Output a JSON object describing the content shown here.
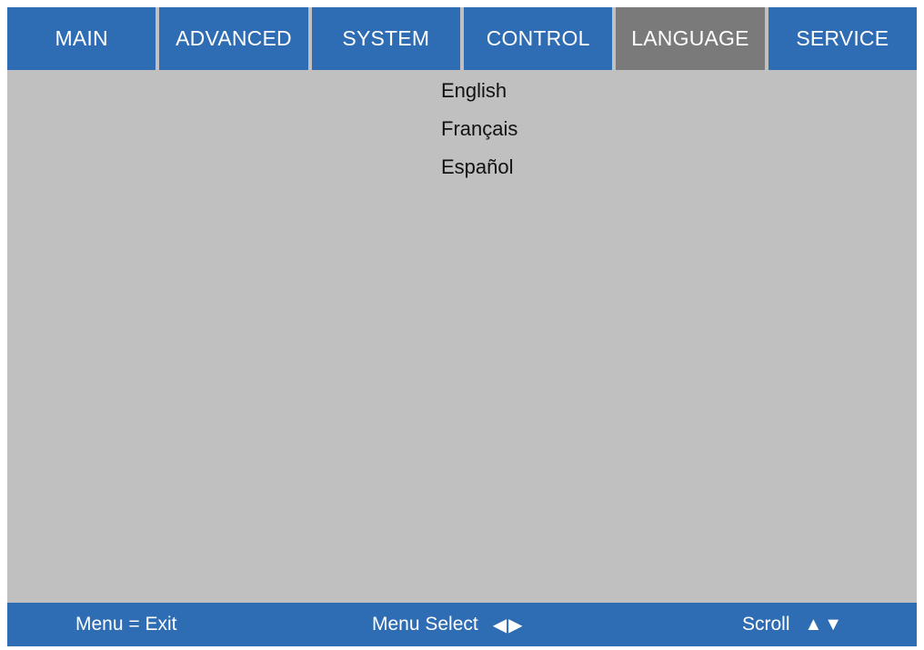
{
  "tabs": [
    {
      "label": "MAIN",
      "active": false
    },
    {
      "label": "ADVANCED",
      "active": false
    },
    {
      "label": "SYSTEM",
      "active": false
    },
    {
      "label": "CONTROL",
      "active": false
    },
    {
      "label": "LANGUAGE",
      "active": true
    },
    {
      "label": "SERVICE",
      "active": false
    }
  ],
  "languages": [
    "English",
    "Français",
    "Español"
  ],
  "footer": {
    "exit_hint": "Menu = Exit",
    "select_hint": "Menu Select",
    "select_glyphs": "◀▶",
    "scroll_hint": "Scroll",
    "scroll_glyphs": "▲▼"
  },
  "colors": {
    "tab_bg": "#2e6cb3",
    "tab_active_bg": "#7a7a7a",
    "content_bg": "#c0c0c0",
    "footer_bg": "#2e6cb3"
  }
}
